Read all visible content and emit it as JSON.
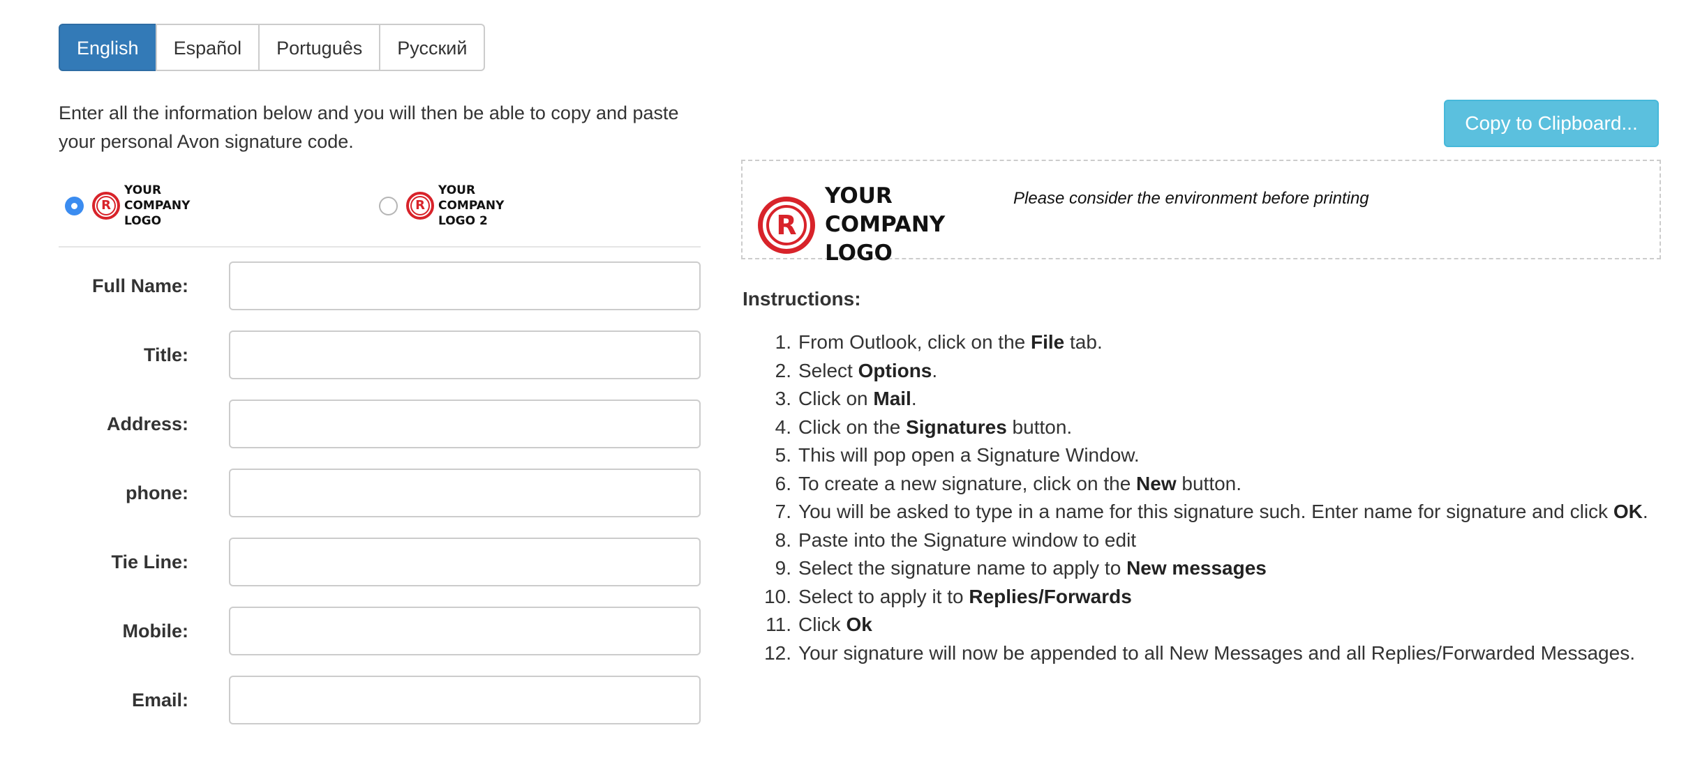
{
  "languages": [
    "English",
    "Español",
    "Português",
    "Русский"
  ],
  "active_language": "English",
  "intro_text": "Enter all the information below and you will then be able to copy and paste your personal Avon signature code.",
  "logo_options": [
    {
      "line1": "YOUR COMPANY",
      "line2": "LOGO",
      "selected": true
    },
    {
      "line1": "YOUR COMPANY",
      "line2": "LOGO 2",
      "selected": false
    }
  ],
  "form": {
    "full_name": {
      "label": "Full Name:",
      "value": ""
    },
    "title": {
      "label": "Title:",
      "value": ""
    },
    "address": {
      "label": "Address:",
      "value": ""
    },
    "phone": {
      "label": "phone:",
      "value": ""
    },
    "tie_line": {
      "label": "Tie Line:",
      "value": ""
    },
    "mobile": {
      "label": "Mobile:",
      "value": ""
    },
    "email": {
      "label": "Email:",
      "value": ""
    }
  },
  "copy_button_label": "Copy to Clipboard...",
  "preview": {
    "logo_line1": "YOUR COMPANY",
    "logo_line2": "LOGO",
    "note": "Please consider the environment before printing"
  },
  "instructions_heading": "Instructions:",
  "instructions": [
    {
      "num": "1.",
      "parts": [
        {
          "t": "From Outlook, click on the "
        },
        {
          "t": "File",
          "b": true
        },
        {
          "t": " tab."
        }
      ]
    },
    {
      "num": "2.",
      "parts": [
        {
          "t": "Select "
        },
        {
          "t": "Options",
          "b": true
        },
        {
          "t": "."
        }
      ]
    },
    {
      "num": "3.",
      "parts": [
        {
          "t": "Click on "
        },
        {
          "t": "Mail",
          "b": true
        },
        {
          "t": "."
        }
      ]
    },
    {
      "num": "4.",
      "parts": [
        {
          "t": "Click on the "
        },
        {
          "t": "Signatures",
          "b": true
        },
        {
          "t": " button."
        }
      ]
    },
    {
      "num": "5.",
      "parts": [
        {
          "t": "This will pop open a Signature Window."
        }
      ]
    },
    {
      "num": "6.",
      "parts": [
        {
          "t": "To create a new signature, click on the "
        },
        {
          "t": "New",
          "b": true
        },
        {
          "t": " button."
        }
      ]
    },
    {
      "num": "7.",
      "parts": [
        {
          "t": "You will be asked to type in a name for this signature such. Enter name for signature and click "
        },
        {
          "t": "OK",
          "b": true
        },
        {
          "t": "."
        }
      ]
    },
    {
      "num": "8.",
      "parts": [
        {
          "t": "Paste into the Signature window to edit"
        }
      ]
    },
    {
      "num": "9.",
      "parts": [
        {
          "t": "Select the signature name to apply to "
        },
        {
          "t": "New messages",
          "b": true
        }
      ]
    },
    {
      "num": "10.",
      "parts": [
        {
          "t": "Select to apply it to "
        },
        {
          "t": "Replies/Forwards",
          "b": true
        }
      ]
    },
    {
      "num": "11.",
      "parts": [
        {
          "t": "Click "
        },
        {
          "t": "Ok",
          "b": true
        }
      ]
    },
    {
      "num": "12.",
      "parts": [
        {
          "t": "Your signature will now be appended to all New Messages and all Replies/Forwarded Messages."
        }
      ]
    }
  ],
  "colors": {
    "primary": "#337ab7",
    "info": "#5bc0de",
    "logo_red": "#d8232a",
    "radio_blue": "#3b8cf0"
  }
}
